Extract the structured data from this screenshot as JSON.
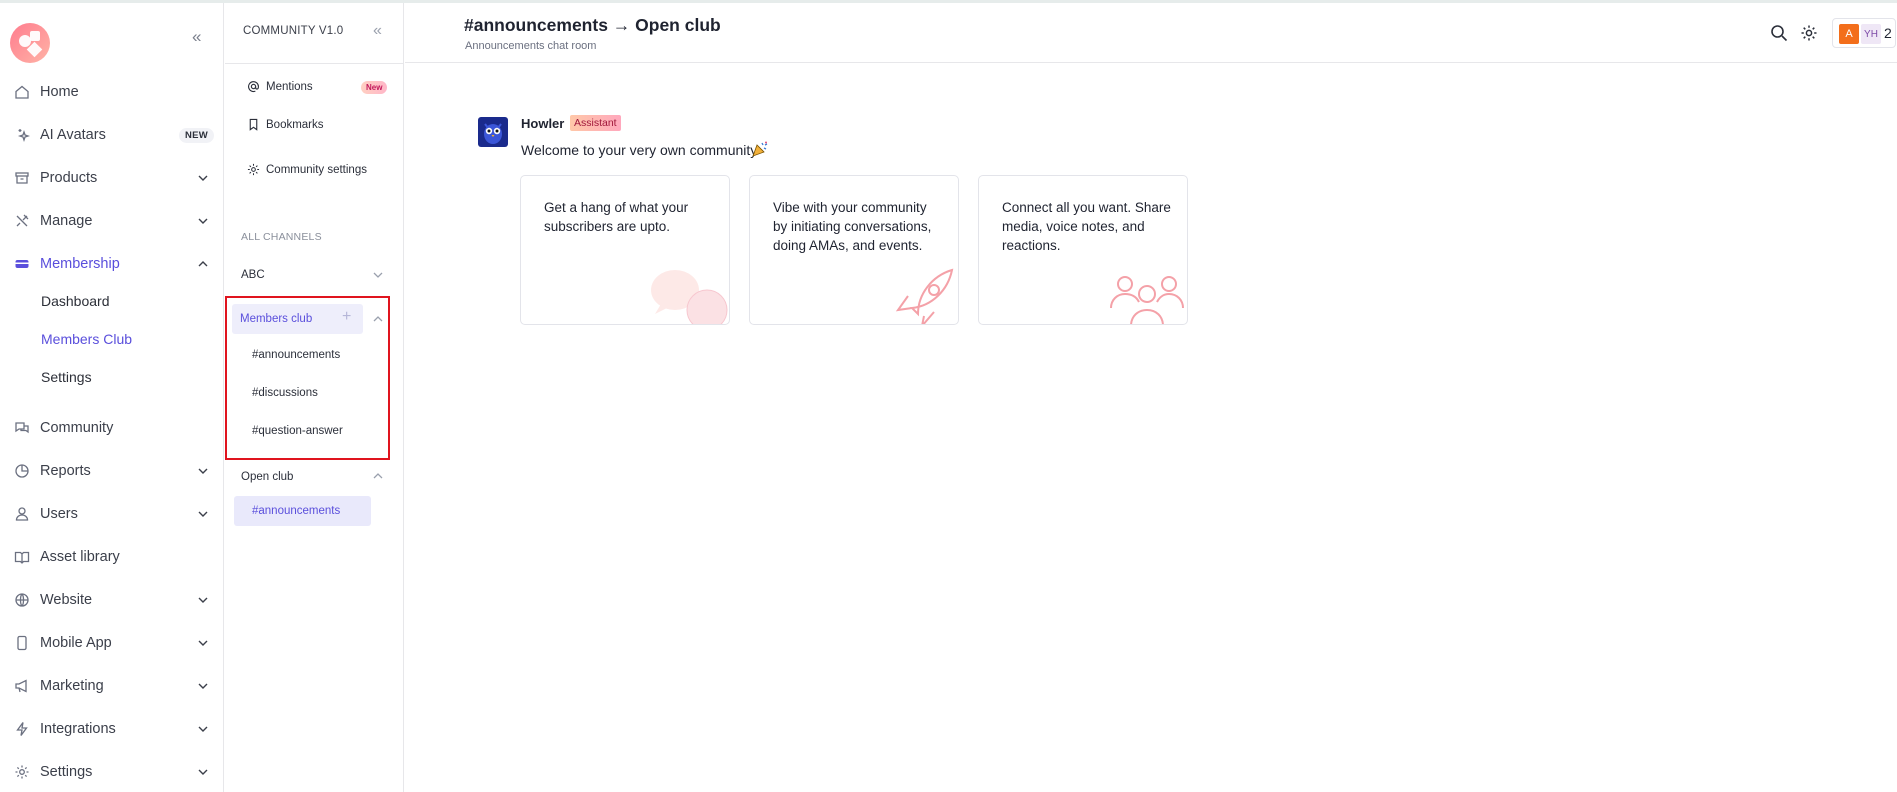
{
  "sidebar": {
    "items": [
      {
        "label": "Home",
        "icon": "home-icon"
      },
      {
        "label": "AI Avatars",
        "icon": "sparkle-icon",
        "badge": "NEW"
      },
      {
        "label": "Products",
        "icon": "box-icon"
      },
      {
        "label": "Manage",
        "icon": "tools-icon"
      },
      {
        "label": "Membership",
        "icon": "membership-icon"
      },
      {
        "label": "Community",
        "icon": "chat-icon"
      },
      {
        "label": "Reports",
        "icon": "pie-chart-icon"
      },
      {
        "label": "Users",
        "icon": "user-icon"
      },
      {
        "label": "Asset library",
        "icon": "book-icon"
      },
      {
        "label": "Website",
        "icon": "globe-icon"
      },
      {
        "label": "Mobile App",
        "icon": "phone-icon"
      },
      {
        "label": "Marketing",
        "icon": "megaphone-icon"
      },
      {
        "label": "Integrations",
        "icon": "bolt-icon"
      },
      {
        "label": "Settings",
        "icon": "gear-icon"
      }
    ],
    "membership_sub": [
      "Dashboard",
      "Members Club",
      "Settings"
    ]
  },
  "community": {
    "title": "COMMUNITY V1.0",
    "mentions": "Mentions",
    "mentions_badge": "New",
    "bookmarks": "Bookmarks",
    "settings": "Community settings",
    "section": "ALL CHANNELS",
    "groups": [
      {
        "label": "ABC",
        "channels": []
      },
      {
        "label": "Members club",
        "channels": [
          "#announcements",
          "#discussions",
          "#question-answer"
        ]
      },
      {
        "label": "Open club",
        "channels": [
          "#announcements"
        ]
      }
    ]
  },
  "header": {
    "title": "#announcements → Open club",
    "subtitle": "Announcements chat room",
    "avatar_a": "A",
    "avatar_yh": "YH",
    "member_count": "2"
  },
  "message": {
    "author": "Howler",
    "tag": "Assistant",
    "text": "Welcome to your very own community",
    "cards": [
      "Get a hang of what your subscribers are upto.",
      "Vibe with your community by initiating conversations, doing AMAs, and events.",
      "Connect all you want. Share media, voice notes, and reactions."
    ]
  },
  "colors": {
    "accent": "#5a4fdc",
    "highlight_border": "#e0141e",
    "avatar_orange": "#f36e1b"
  }
}
